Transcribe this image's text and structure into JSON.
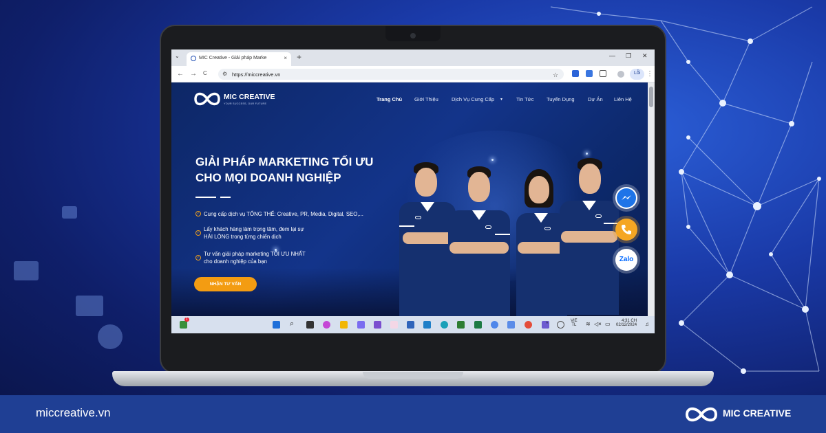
{
  "browser": {
    "tab_title": "MIC Creative - Giải pháp Marke",
    "tab_close": "×",
    "new_tab": "+",
    "tab_list": "⌄",
    "url": "https://miccreative.vn",
    "back": "←",
    "forward": "→",
    "reload": "C",
    "star": "☆",
    "profile_label": "Lỗi",
    "menu_more": "⋮",
    "minimize": "—",
    "restore": "❐",
    "close": "✕"
  },
  "site": {
    "logo_name": "MIC CREATIVE",
    "logo_tagline": "YOUR SUCCESS, OUR FUTURE",
    "nav": [
      {
        "label": "Trang Chủ"
      },
      {
        "label": "Giới Thiệu"
      },
      {
        "label": "Dịch Vụ Cung Cấp"
      },
      {
        "label": "Tin Tức"
      },
      {
        "label": "Tuyển Dụng"
      },
      {
        "label": "Dự Án"
      },
      {
        "label": "Liên Hệ"
      }
    ],
    "hero_title_line1": "GIẢI PHÁP MARKETING TỐI ƯU",
    "hero_title_line2": "CHO MỌI DOANH NGHIỆP",
    "bullets": [
      {
        "line1": "Cung cấp dịch vụ TỔNG THỂ: Creative, PR, Media, Digital, SEO,...",
        "line2": ""
      },
      {
        "line1": "Lấy khách hàng làm trọng tâm, đem lại sự",
        "line2": "HÀI LÒNG trong từng chiến dịch"
      },
      {
        "line1": "Tư vấn giải pháp marketing TỐI ƯU NHẤT",
        "line2": "cho doanh nghiệp của bạn"
      }
    ],
    "cta": "NHẬN TƯ VẤN",
    "zalo": "Zalo",
    "messenger_icon": "messenger-icon",
    "phone_icon": "phone-icon"
  },
  "taskbar": {
    "language_line1": "VIE",
    "language_line2": "TL",
    "time": "4:31 CH",
    "date": "02/12/2024",
    "notification_count": "1"
  },
  "footer": {
    "url": "miccreative.vn",
    "brand": "MIC CREATIVE"
  },
  "colors": {
    "brand_blue": "#1f3f94",
    "cta_orange": "#f39c12",
    "hero_bg": "#13348a"
  }
}
